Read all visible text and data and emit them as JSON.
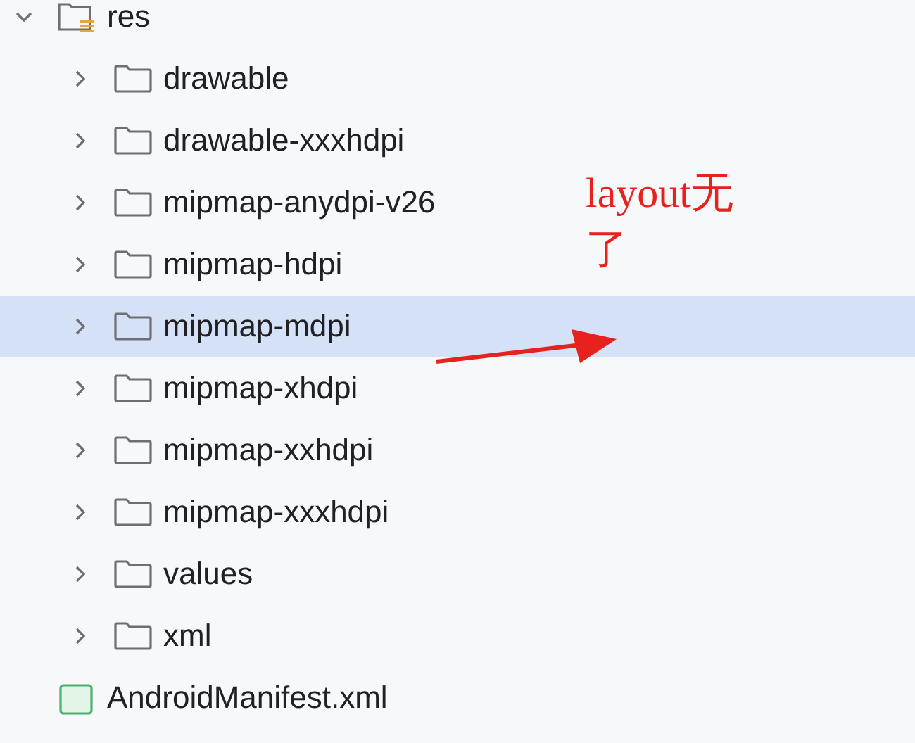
{
  "tree": [
    {
      "name": "res",
      "kind": "resource-folder",
      "expanded": true,
      "selected": false,
      "children": [
        {
          "name": "drawable",
          "kind": "folder",
          "expanded": false,
          "selected": false
        },
        {
          "name": "drawable-xxxhdpi",
          "kind": "folder",
          "expanded": false,
          "selected": false
        },
        {
          "name": "mipmap-anydpi-v26",
          "kind": "folder",
          "expanded": false,
          "selected": false
        },
        {
          "name": "mipmap-hdpi",
          "kind": "folder",
          "expanded": false,
          "selected": false
        },
        {
          "name": "mipmap-mdpi",
          "kind": "folder",
          "expanded": false,
          "selected": true
        },
        {
          "name": "mipmap-xhdpi",
          "kind": "folder",
          "expanded": false,
          "selected": false
        },
        {
          "name": "mipmap-xxhdpi",
          "kind": "folder",
          "expanded": false,
          "selected": false
        },
        {
          "name": "mipmap-xxxhdpi",
          "kind": "folder",
          "expanded": false,
          "selected": false
        },
        {
          "name": "values",
          "kind": "folder",
          "expanded": false,
          "selected": false
        },
        {
          "name": "xml",
          "kind": "folder",
          "expanded": false,
          "selected": false
        }
      ]
    },
    {
      "name": "AndroidManifest.xml",
      "kind": "xml-file",
      "selected": false
    }
  ],
  "annotation": {
    "text": "layout无了"
  }
}
